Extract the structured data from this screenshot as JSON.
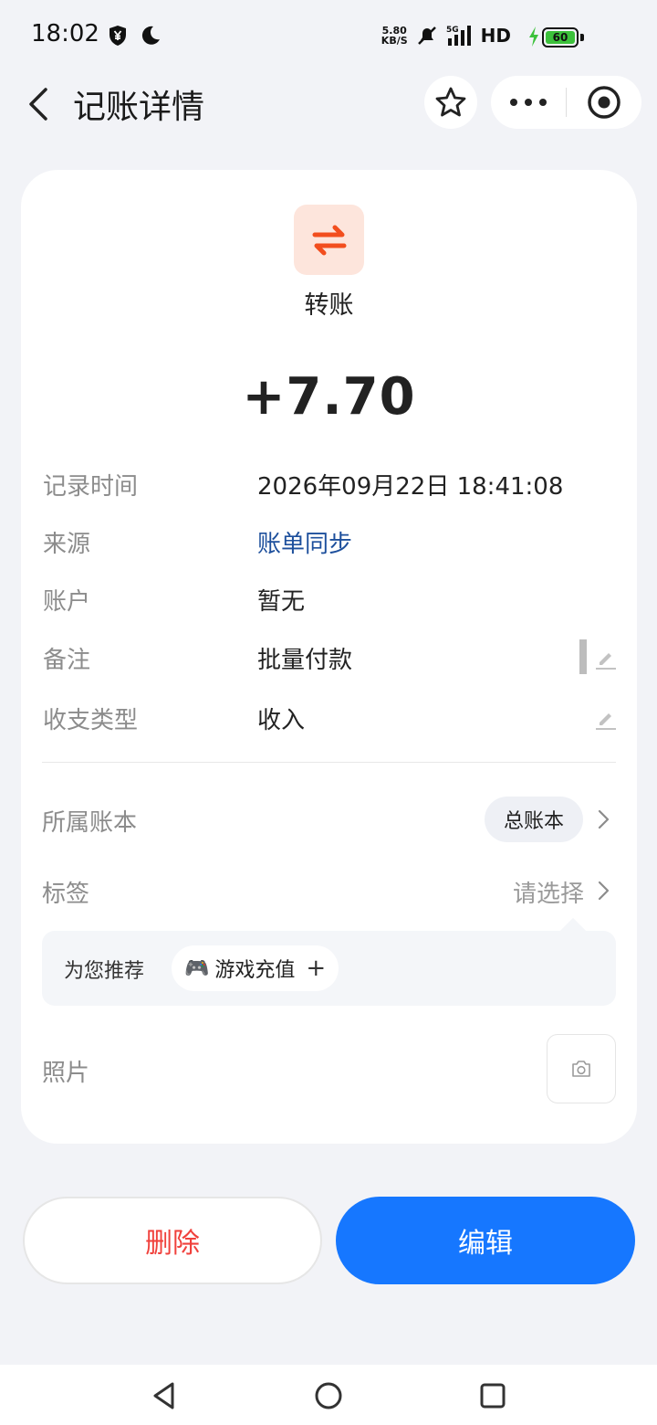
{
  "status_bar": {
    "time": "18:02",
    "net_speed_value": "5.80",
    "net_speed_unit": "KB/S",
    "signal_label": "5G",
    "hd_label": "HD",
    "battery": "60"
  },
  "header": {
    "title": "记账详情"
  },
  "record": {
    "type_name": "转账",
    "amount": "+7.70",
    "rows": [
      {
        "label": "记录时间",
        "value": "2026年09月22日 18:41:08"
      },
      {
        "label": "来源",
        "value": "账单同步"
      },
      {
        "label": "账户",
        "value": "暂无"
      },
      {
        "label": "备注",
        "value": "批量付款"
      },
      {
        "label": "收支类型",
        "value": "收入"
      }
    ]
  },
  "ledger": {
    "label": "所属账本",
    "value": "总账本"
  },
  "tags": {
    "label": "标签",
    "placeholder": "请选择",
    "recommend_label": "为您推荐",
    "recommend_chip": "游戏充值",
    "recommend_emoji": "🎮",
    "plus": "+"
  },
  "photo": {
    "label": "照片"
  },
  "actions": {
    "delete": "删除",
    "edit": "编辑"
  },
  "colors": {
    "accent": "#1677ff",
    "danger": "#f0413c",
    "link": "#1d4f9c",
    "transfer_icon": "#f24e1e"
  },
  "icons": [
    "back-icon",
    "star-icon",
    "more-icon",
    "target-icon",
    "transfer-icon",
    "edit-pencil-icon",
    "chevron-right-icon",
    "camera-icon",
    "nav-back-icon",
    "nav-home-icon",
    "nav-recents-icon"
  ]
}
